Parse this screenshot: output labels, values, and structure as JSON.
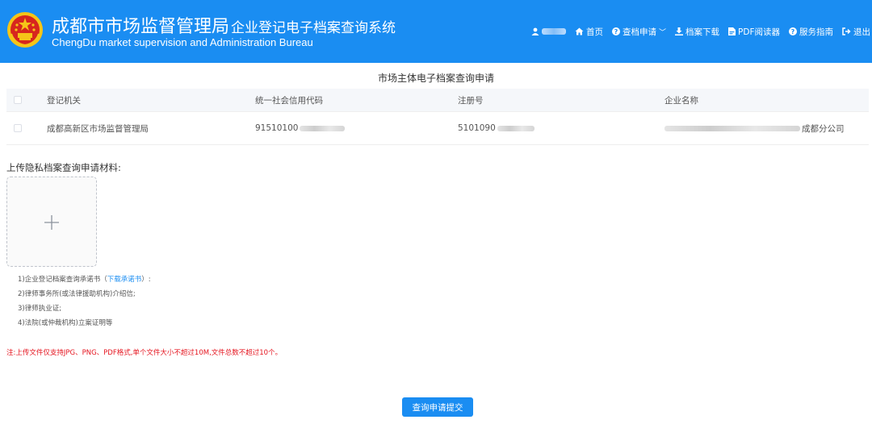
{
  "header": {
    "title_main": "成都市市场监督管理局",
    "title_sub": "企业登记电子档案查询系统",
    "title_en": "ChengDu market supervision and Administration Bureau",
    "nav": {
      "home": "首页",
      "apply": "查档申请",
      "download": "档案下载",
      "pdf_reader": "PDF阅读器",
      "guide": "服务指南",
      "logout": "退出"
    },
    "icons": [
      "user-icon",
      "home-icon",
      "question-icon",
      "download-icon",
      "pdf-icon",
      "question-icon",
      "logout-icon"
    ]
  },
  "page": {
    "title": "市场主体电子档案查询申请"
  },
  "table": {
    "headers": [
      "登记机关",
      "统一社会信用代码",
      "注册号",
      "企业名称"
    ],
    "rows": [
      {
        "authority": "成都高新区市场监督管理局",
        "credit_code": "91510100",
        "reg_no": "5101090",
        "company_name": "成都分公司"
      }
    ]
  },
  "upload": {
    "label": "上传隐私档案查询申请材料:",
    "note_1_prefix": "1)企业登记档案查询承诺书（",
    "note_1_link": "下载承诺书",
    "note_1_suffix": "）:",
    "note_2": "2)律师事务所(或法律援助机构)介绍信;",
    "note_3": "3)律师执业证;",
    "note_4": "4)法院(或仲裁机构)立案证明等",
    "warning": "注:上传文件仅支持JPG、PNG、PDF格式,单个文件大小不超过10M,文件总数不超过10个。"
  },
  "actions": {
    "submit": "查询申请提交"
  },
  "colors": {
    "header_bg": "#1a8df2",
    "link": "#1a8df2",
    "warning": "#e5141f"
  }
}
